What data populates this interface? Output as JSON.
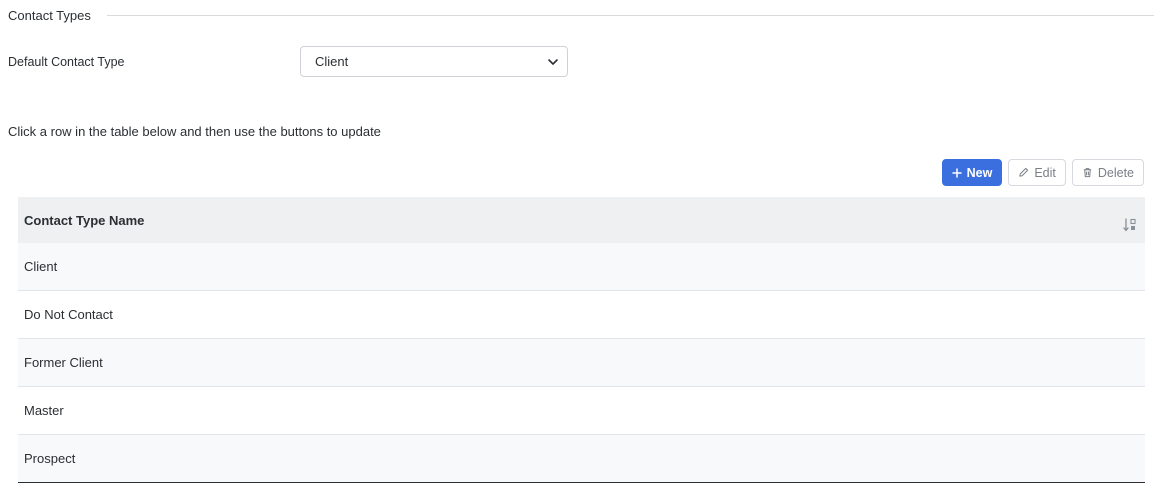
{
  "section": {
    "title": "Contact Types"
  },
  "default_contact_type": {
    "label": "Default Contact Type",
    "selected": "Client"
  },
  "instructions": "Click a row in the table below and then use the buttons to update",
  "toolbar": {
    "new_label": "New",
    "edit_label": "Edit",
    "delete_label": "Delete"
  },
  "table": {
    "column_header": "Contact Type Name",
    "rows": [
      "Client",
      "Do Not Contact",
      "Former Client",
      "Master",
      "Prospect"
    ]
  },
  "colors": {
    "primary": "#3b6fe0",
    "header_bg": "#eef0f2",
    "row_alt_bg": "#f8f9fa"
  },
  "icons": {
    "new": "plus-icon",
    "edit": "pencil-icon",
    "delete": "trash-icon",
    "select": "chevron-down-icon",
    "sort": "sort-numeric-icon"
  }
}
